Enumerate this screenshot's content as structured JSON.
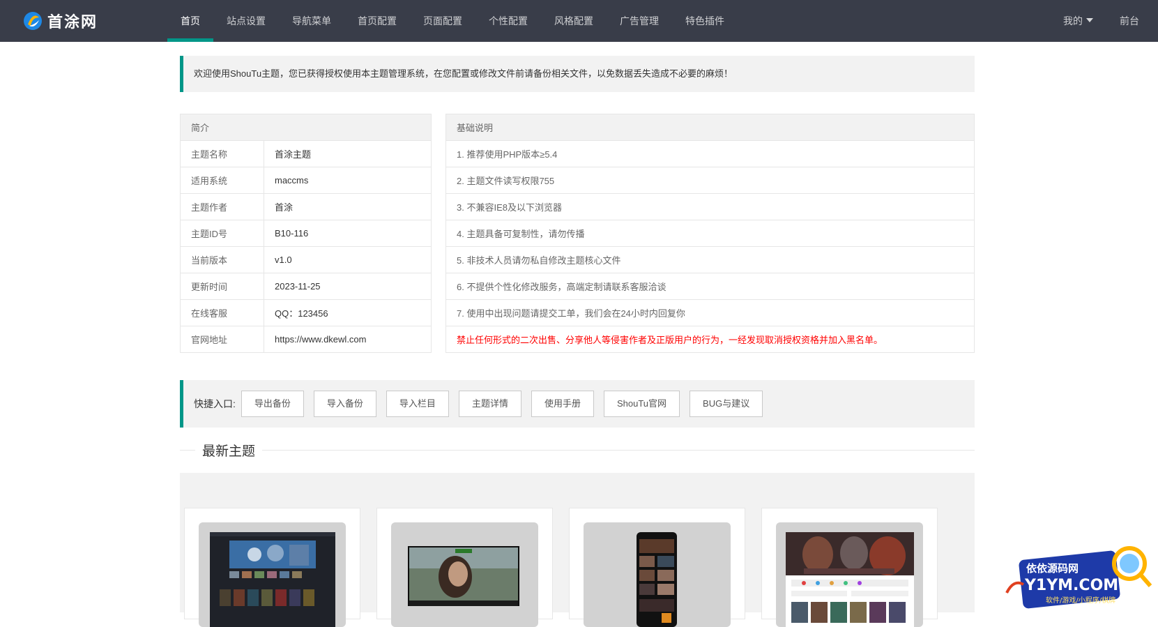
{
  "brand": {
    "name": "首涂网"
  },
  "nav": {
    "items": [
      {
        "label": "首页",
        "active": true
      },
      {
        "label": "站点设置"
      },
      {
        "label": "导航菜单"
      },
      {
        "label": "首页配置"
      },
      {
        "label": "页面配置"
      },
      {
        "label": "个性配置"
      },
      {
        "label": "风格配置"
      },
      {
        "label": "广告管理"
      },
      {
        "label": "特色插件"
      }
    ],
    "right": {
      "mine": "我的",
      "frontend": "前台"
    }
  },
  "notice": "欢迎使用ShouTu主题，您已获得授权使用本主题管理系统，在您配置或修改文件前请备份相关文件，以免数据丢失造成不必要的麻烦！",
  "intro": {
    "header": "简介",
    "rows": [
      {
        "key": "主题名称",
        "value": "首涂主题"
      },
      {
        "key": "适用系统",
        "value": "maccms"
      },
      {
        "key": "主题作者",
        "value": "首涂"
      },
      {
        "key": "主题ID号",
        "value": "B10-116"
      },
      {
        "key": "当前版本",
        "value": "v1.0"
      },
      {
        "key": "更新时间",
        "value": "2023-11-25"
      },
      {
        "key": "在线客服",
        "value": "QQ：123456"
      },
      {
        "key": "官网地址",
        "value": "https://www.dkewl.com"
      }
    ]
  },
  "basics": {
    "header": "基础说明",
    "rows": [
      "1. 推荐使用PHP版本≥5.4",
      "2. 主题文件读写权限755",
      "3. 不兼容IE8及以下浏览器",
      "4. 主题具备可复制性，请勿传播",
      "5. 非技术人员请勿私自修改主题核心文件",
      "6. 不提供个性化修改服务，高端定制请联系客服洽谈",
      "7. 使用中出现问题请提交工单，我们会在24小时内回复你"
    ],
    "warning": "禁止任何形式的二次出售、分享他人等侵害作者及正版用户的行为，一经发现取消授权资格并加入黑名单。"
  },
  "quick": {
    "label": "快捷入口:",
    "buttons": [
      "导出备份",
      "导入备份",
      "导入栏目",
      "主题详情",
      "使用手册",
      "ShouTu官网",
      "BUG与建议"
    ]
  },
  "latest": {
    "title": "最新主题"
  },
  "watermark": {
    "line1": "依依源码网",
    "line2": "Y1YM.COM",
    "line3": "软件/游戏/小程序/棋牌"
  },
  "colors": {
    "topbar": "#393d49",
    "accent": "#009688",
    "warning": "#ff0000",
    "panel": "#f2f2f2"
  }
}
